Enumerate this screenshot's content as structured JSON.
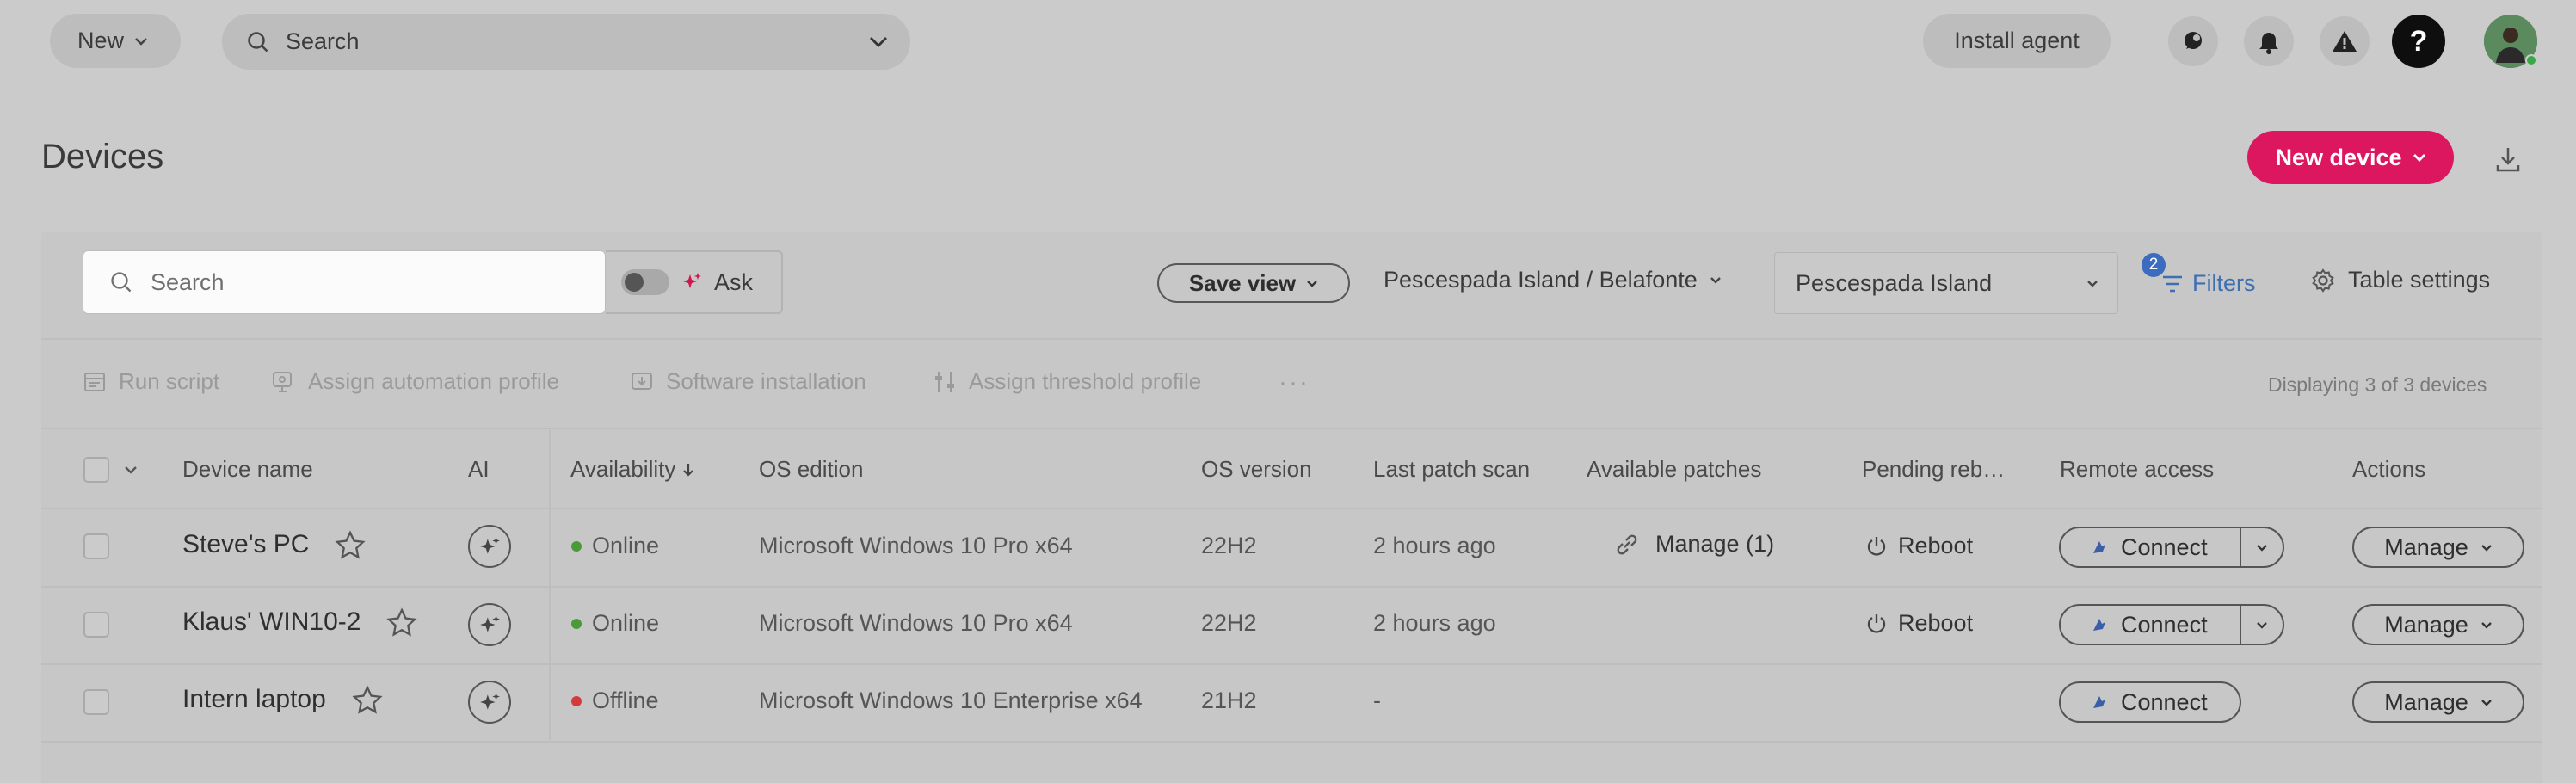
{
  "topbar": {
    "new_label": "New",
    "search_label": "Search",
    "install_label": "Install agent",
    "help_label": "?"
  },
  "page": {
    "title": "Devices",
    "new_device_label": "New device"
  },
  "toolbar": {
    "search_placeholder": "Search",
    "ask_label": "Ask",
    "save_view_label": "Save view",
    "location_path": "Pescespada Island / Belafonte",
    "location_select": "Pescespada Island",
    "filters_label": "Filters",
    "filters_count": "2",
    "table_settings_label": "Table settings"
  },
  "actions": {
    "run_script": "Run script",
    "assign_automation": "Assign automation profile",
    "software_install": "Software installation",
    "assign_threshold": "Assign threshold profile",
    "more": "···",
    "displaying": "Displaying 3 of 3 devices"
  },
  "table": {
    "headers": {
      "device_name": "Device name",
      "ai": "AI",
      "availability": "Availability",
      "os_edition": "OS edition",
      "os_version": "OS version",
      "last_patch_scan": "Last patch scan",
      "available_patches": "Available patches",
      "pending_reboot": "Pending reb…",
      "remote_access": "Remote access",
      "actions": "Actions"
    },
    "rows": [
      {
        "name": "Steve's PC",
        "status": "Online",
        "os_edition": "Microsoft Windows 10 Pro x64",
        "os_version": "22H2",
        "last_scan": "2 hours ago",
        "patches": "Manage (1)",
        "reboot": "Reboot",
        "connect": "Connect",
        "manage": "Manage"
      },
      {
        "name": "Klaus' WIN10-2",
        "status": "Online",
        "os_edition": "Microsoft Windows 10 Pro x64",
        "os_version": "22H2",
        "last_scan": "2 hours ago",
        "patches": "",
        "reboot": "Reboot",
        "connect": "Connect",
        "manage": "Manage"
      },
      {
        "name": "Intern laptop",
        "status": "Offline",
        "os_edition": "Microsoft Windows 10 Enterprise x64",
        "os_version": "21H2",
        "last_scan": "-",
        "patches": "",
        "reboot": "",
        "connect": "Connect",
        "manage": "Manage"
      }
    ]
  },
  "colors": {
    "accent": "#dd1660",
    "online": "#4a9a3a",
    "offline": "#d23c3c",
    "link": "#3d6fb1"
  }
}
